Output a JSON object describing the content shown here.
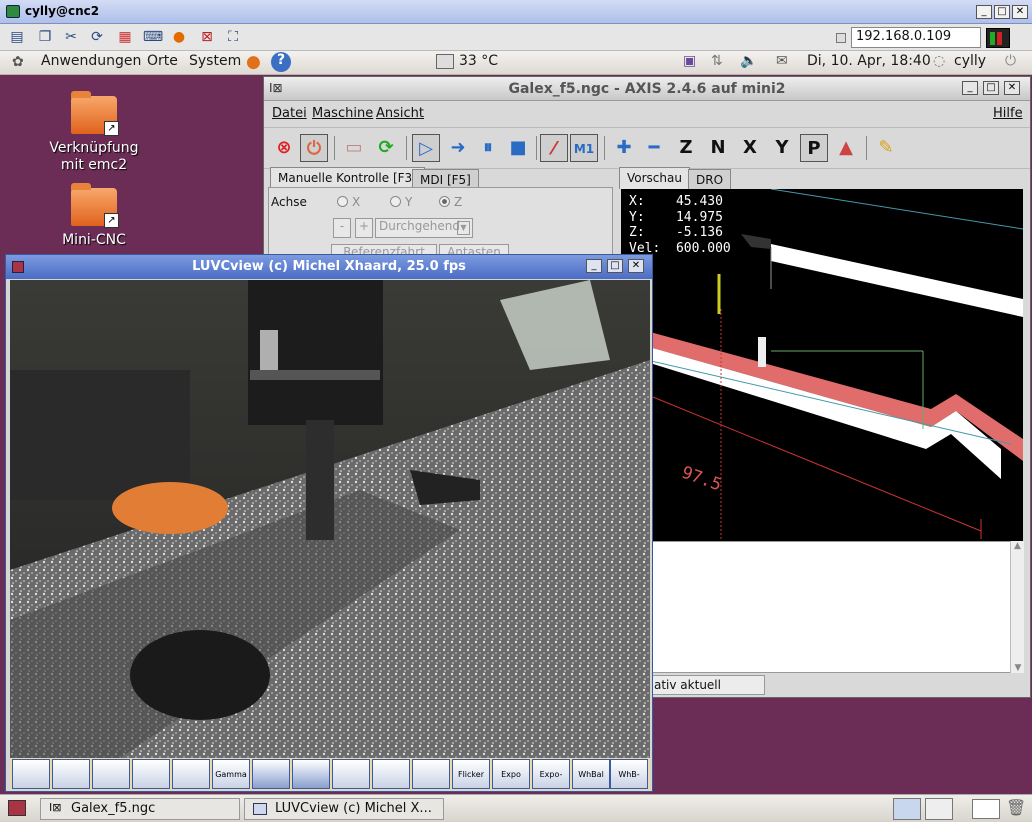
{
  "vnc": {
    "title": "cylly@cnc2",
    "ip": "192.168.0.109"
  },
  "panel": {
    "applications": "Anwendungen",
    "places": "Orte",
    "system": "System",
    "temperature": "33 °C",
    "datetime": "Di, 10. Apr, 18:40",
    "user": "cylly"
  },
  "desktop": {
    "icons": [
      {
        "label": "Verknüpfung mit emc2"
      },
      {
        "label": "Mini-CNC"
      }
    ]
  },
  "axis": {
    "title": "Galex_f5.ngc - AXIS 2.4.6 auf  mini2",
    "menu": {
      "file": "Datei",
      "machine": "Maschine",
      "view": "Ansicht",
      "help": "Hilfe"
    },
    "tabs_left": [
      "Manuelle Kontrolle [F3]",
      "MDI [F5]"
    ],
    "tabs_right": [
      "Vorschau",
      "DRO"
    ],
    "axis_label": "Achse",
    "axes": [
      "X",
      "Y",
      "Z"
    ],
    "jog_minus": "-",
    "jog_plus": "+",
    "jog_mode": "Durchgehend",
    "home_button": "Referenzfahrt",
    "touch_off_button": "Antasten",
    "dro": {
      "x": "X:    45.430",
      "y": "Y:    14.975",
      "z": "Z:    -5.136",
      "vel": "Vel:  600.000"
    },
    "preview_dimension": "97.5",
    "status": "ativ aktuell"
  },
  "luvc": {
    "title": "LUVCview (c) Michel Xhaard, 25.0 fps",
    "buttons": [
      "",
      "",
      "",
      "",
      "",
      "Gamma",
      "",
      "",
      "",
      "",
      "",
      "Flicker",
      "Expo",
      "Expo-Auto",
      "WhBal",
      "WhB-Auto"
    ]
  },
  "taskbar": {
    "tasks": [
      "Galex_f5.ngc",
      "LUVCview (c) Michel X..."
    ]
  },
  "colors": {
    "desktop": "#6b2d55",
    "preview_bg": "#000000",
    "toolpath_red": "#e06c6c"
  }
}
